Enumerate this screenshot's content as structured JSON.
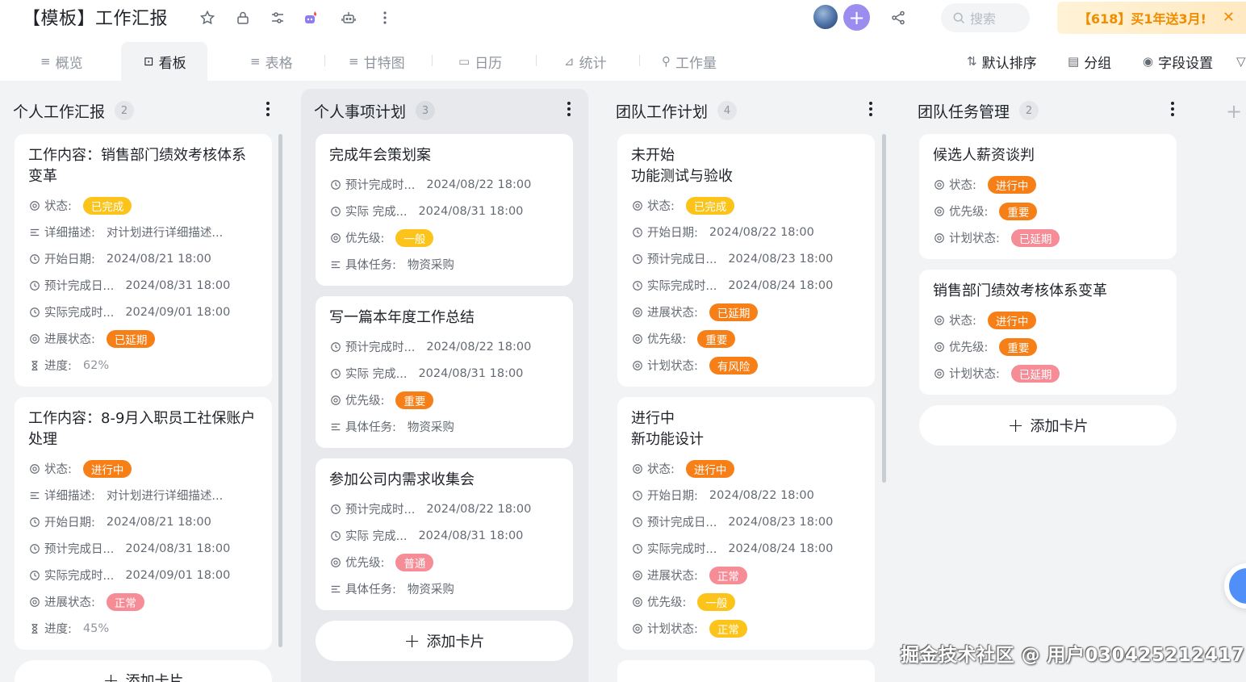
{
  "header": {
    "title": "【模板】工作汇报",
    "search_placeholder": "搜索",
    "promo_text": "【618】买1年送3月!",
    "promo_close": "✕"
  },
  "view_tabs": [
    {
      "icon": "≡",
      "label": "概览"
    },
    {
      "icon": "⊡",
      "label": "看板"
    },
    {
      "icon": "≡",
      "label": "表格"
    },
    {
      "icon": "≡",
      "label": "甘特图"
    },
    {
      "icon": "▭",
      "label": "日历"
    },
    {
      "icon": "⊿",
      "label": "统计"
    },
    {
      "icon": "⚲",
      "label": "工作量"
    }
  ],
  "toolbar": {
    "sort_label": "默认排序",
    "group_label": "分组",
    "fields_label": "字段设置"
  },
  "colors": {
    "orange": "#f77f17",
    "yellow": "#fcc41b",
    "pink": "#f58c96",
    "accent": "#a99bf5"
  },
  "columns": [
    {
      "title": "个人工作汇报",
      "count": "2",
      "cards": [
        {
          "title": "工作内容：销售部门绩效考核体系变革",
          "fields": [
            {
              "icon": "status",
              "label": "状态:",
              "badge": "已完成",
              "color": "yellow"
            },
            {
              "icon": "list",
              "label": "详细描述:",
              "value": "对计划进行详细描述..."
            },
            {
              "icon": "clock",
              "label": "开始日期:",
              "value": "2024/08/21 18:00"
            },
            {
              "icon": "clock",
              "label": "预计完成日...",
              "value": "2024/08/31 18:00"
            },
            {
              "icon": "clock",
              "label": "实际完成时...",
              "value": "2024/09/01 18:00"
            },
            {
              "icon": "status",
              "label": "进展状态:",
              "badge": "已延期",
              "color": "orange"
            },
            {
              "icon": "hourglass",
              "label": "进度:",
              "value": "62%",
              "muted": true
            }
          ]
        },
        {
          "title": "工作内容：8-9月入职员工社保账户处理",
          "fields": [
            {
              "icon": "status",
              "label": "状态:",
              "badge": "进行中",
              "color": "orange"
            },
            {
              "icon": "list",
              "label": "详细描述:",
              "value": "对计划进行详细描述..."
            },
            {
              "icon": "clock",
              "label": "开始日期:",
              "value": "2024/08/21 18:00"
            },
            {
              "icon": "clock",
              "label": "预计完成日...",
              "value": "2024/08/31 18:00"
            },
            {
              "icon": "clock",
              "label": "实际完成时...",
              "value": "2024/09/01 18:00"
            },
            {
              "icon": "status",
              "label": "进展状态:",
              "badge": "正常",
              "color": "pink"
            },
            {
              "icon": "hourglass",
              "label": "进度:",
              "value": "45%",
              "muted": true
            }
          ]
        }
      ],
      "add_label": "添加卡片"
    },
    {
      "title": "个人事项计划",
      "count": "3",
      "cards": [
        {
          "title": "完成年会策划案",
          "fields": [
            {
              "icon": "clock",
              "label": "预计完成时...",
              "value": "2024/08/22 18:00"
            },
            {
              "icon": "clock",
              "label": "实际 完成...",
              "value": "2024/08/31 18:00"
            },
            {
              "icon": "status",
              "label": "优先级:",
              "badge": "一般",
              "color": "yellow"
            },
            {
              "icon": "list",
              "label": "具体任务:",
              "value": "物资采购"
            }
          ]
        },
        {
          "title": "写一篇本年度工作总结",
          "fields": [
            {
              "icon": "clock",
              "label": "预计完成时...",
              "value": "2024/08/22 18:00"
            },
            {
              "icon": "clock",
              "label": "实际 完成...",
              "value": "2024/08/31 18:00"
            },
            {
              "icon": "status",
              "label": "优先级:",
              "badge": "重要",
              "color": "orange"
            },
            {
              "icon": "list",
              "label": "具体任务:",
              "value": "物资采购"
            }
          ]
        },
        {
          "title": "参加公司内需求收集会",
          "fields": [
            {
              "icon": "clock",
              "label": "预计完成时...",
              "value": "2024/08/22 18:00"
            },
            {
              "icon": "clock",
              "label": "实际 完成...",
              "value": "2024/08/31 18:00"
            },
            {
              "icon": "status",
              "label": "优先级:",
              "badge": "普通",
              "color": "pink"
            },
            {
              "icon": "list",
              "label": "具体任务:",
              "value": "物资采购"
            }
          ]
        }
      ],
      "add_label": "添加卡片"
    },
    {
      "title": "团队工作计划",
      "count": "4",
      "cards": [
        {
          "title": "未开始",
          "subtitle": "功能测试与验收",
          "fields": [
            {
              "icon": "status",
              "label": "状态:",
              "badge": "已完成",
              "color": "yellow"
            },
            {
              "icon": "clock",
              "label": "开始日期:",
              "value": "2024/08/22 18:00"
            },
            {
              "icon": "clock",
              "label": "预计完成日...",
              "value": "2024/08/23 18:00"
            },
            {
              "icon": "clock",
              "label": "实际完成时...",
              "value": "2024/08/24 18:00"
            },
            {
              "icon": "status",
              "label": "进展状态:",
              "badge": "已延期",
              "color": "orange"
            },
            {
              "icon": "status",
              "label": "优先级:",
              "badge": "重要",
              "color": "orange"
            },
            {
              "icon": "status",
              "label": "计划状态:",
              "badge": "有风险",
              "color": "orange"
            }
          ]
        },
        {
          "title": "进行中",
          "subtitle": "新功能设计",
          "fields": [
            {
              "icon": "status",
              "label": "状态:",
              "badge": "进行中",
              "color": "orange"
            },
            {
              "icon": "clock",
              "label": "开始日期:",
              "value": "2024/08/22 18:00"
            },
            {
              "icon": "clock",
              "label": "预计完成日...",
              "value": "2024/08/23 18:00"
            },
            {
              "icon": "clock",
              "label": "实际完成时...",
              "value": "2024/08/24 18:00"
            },
            {
              "icon": "status",
              "label": "进展状态:",
              "badge": "正常",
              "color": "pink"
            },
            {
              "icon": "status",
              "label": "优先级:",
              "badge": "一般",
              "color": "yellow"
            },
            {
              "icon": "status",
              "label": "计划状态:",
              "badge": "正常",
              "color": "yellow"
            }
          ]
        }
      ]
    },
    {
      "title": "团队任务管理",
      "count": "2",
      "cards": [
        {
          "title": "候选人薪资谈判",
          "fields": [
            {
              "icon": "status",
              "label": "状态:",
              "badge": "进行中",
              "color": "orange"
            },
            {
              "icon": "status",
              "label": "优先级:",
              "badge": "重要",
              "color": "orange"
            },
            {
              "icon": "status",
              "label": "计划状态:",
              "badge": "已延期",
              "color": "pink"
            }
          ]
        },
        {
          "title": "销售部门绩效考核体系变革",
          "fields": [
            {
              "icon": "status",
              "label": "状态:",
              "badge": "进行中",
              "color": "orange"
            },
            {
              "icon": "status",
              "label": "优先级:",
              "badge": "重要",
              "color": "orange"
            },
            {
              "icon": "status",
              "label": "计划状态:",
              "badge": "已延期",
              "color": "pink"
            }
          ]
        }
      ],
      "add_label": "添加卡片"
    }
  ],
  "watermark": "掘金技术社区 @ 用户030425212417"
}
